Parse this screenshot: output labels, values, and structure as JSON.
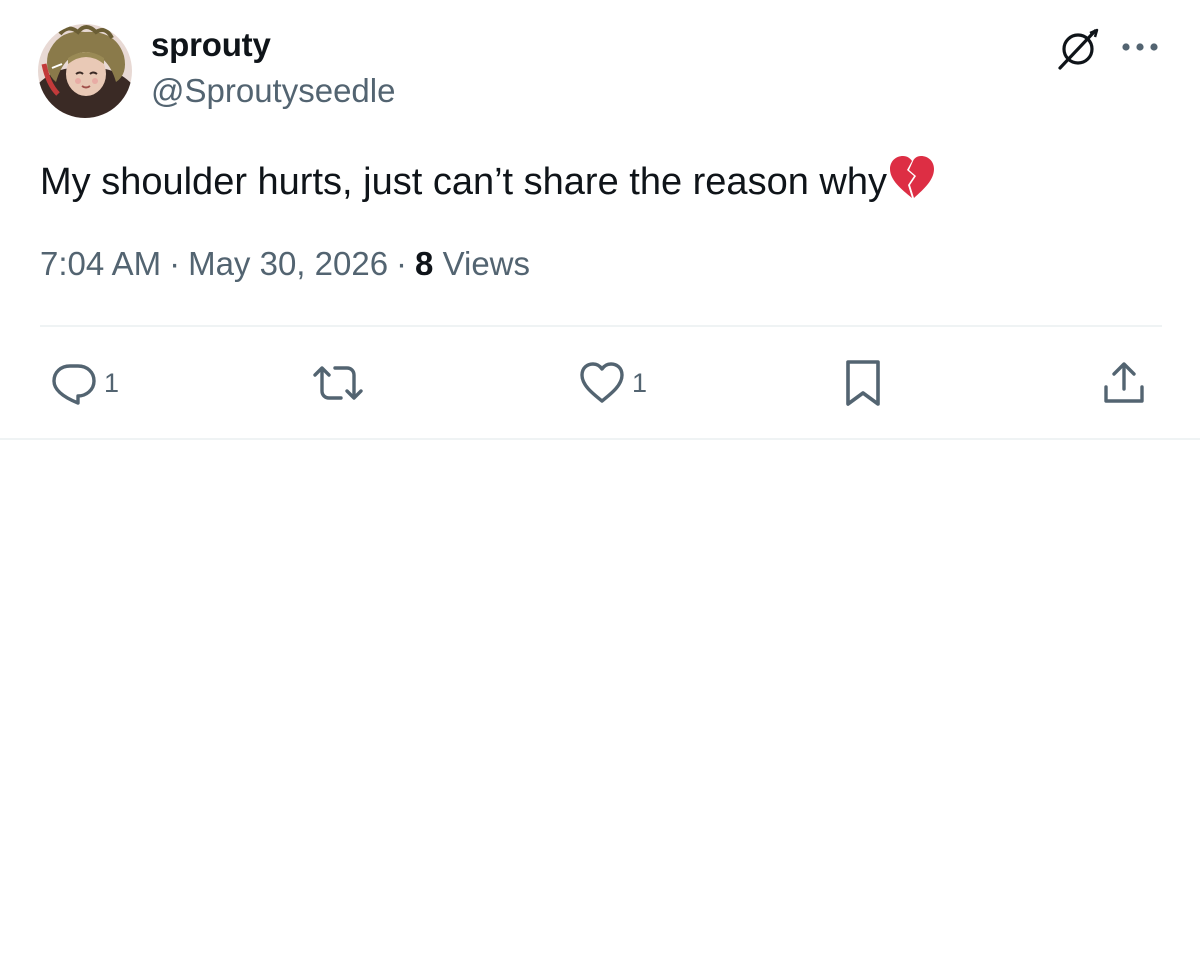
{
  "author": {
    "display_name": "sprouty",
    "handle": "@Sproutyseedle"
  },
  "tweet": {
    "text": "My shoulder hurts, just can’t share the reason why",
    "emoji": "broken-heart"
  },
  "meta": {
    "time": "7:04 AM",
    "separator": "·",
    "date": "May 30, 2026",
    "views_count": "8",
    "views_label": "Views"
  },
  "actions": {
    "replies": "1",
    "likes": "1"
  },
  "icons": {
    "top_right": [
      "grok-icon",
      "more-icon"
    ],
    "action_bar": [
      "reply-icon",
      "retweet-icon",
      "like-icon",
      "bookmark-icon",
      "share-icon"
    ]
  },
  "colors": {
    "text_primary": "#0f1419",
    "text_secondary": "#536471",
    "divider": "#eff3f4",
    "emoji_red": "#dd2e44"
  }
}
